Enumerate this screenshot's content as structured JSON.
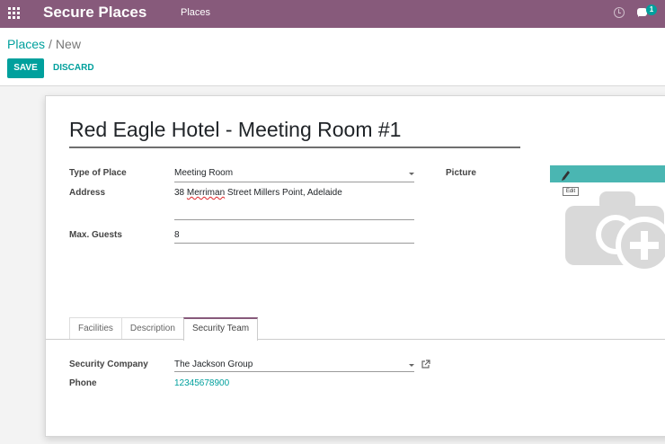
{
  "navbar": {
    "brand": "Secure Places",
    "menu_item": "Places",
    "badge_count": "1"
  },
  "breadcrumb": {
    "parent": "Places",
    "separator": "/",
    "current": "New"
  },
  "actions": {
    "save_label": "SAVE",
    "discard_label": "DISCARD"
  },
  "form": {
    "title": "Red Eagle Hotel - Meeting Room #1",
    "type_label": "Type of Place",
    "type_value": "Meeting Room",
    "address_label": "Address",
    "address_value": "38 Merriman Street Millers Point, Adelaide",
    "address_prefix": "38 ",
    "address_misspelled": "Merriman",
    "address_suffix": " Street Millers Point, Adelaide",
    "guests_label": "Max. Guests",
    "guests_value": "8",
    "picture_label": "Picture",
    "picture_tooltip": "Edit"
  },
  "tabs": [
    {
      "label": "Facilities",
      "active": false
    },
    {
      "label": "Description",
      "active": false
    },
    {
      "label": "Security Team",
      "active": true
    }
  ],
  "security": {
    "company_label": "Security Company",
    "company_value": "The Jackson Group",
    "phone_label": "Phone",
    "phone_value": "12345678900"
  },
  "colors": {
    "brand": "#875a7b",
    "accent": "#00a09d"
  },
  "icons": [
    "apps-grid-icon",
    "clock-icon",
    "chat-icon",
    "pencil-icon",
    "camera-plus-icon",
    "external-link-icon",
    "dropdown-caret-icon"
  ]
}
